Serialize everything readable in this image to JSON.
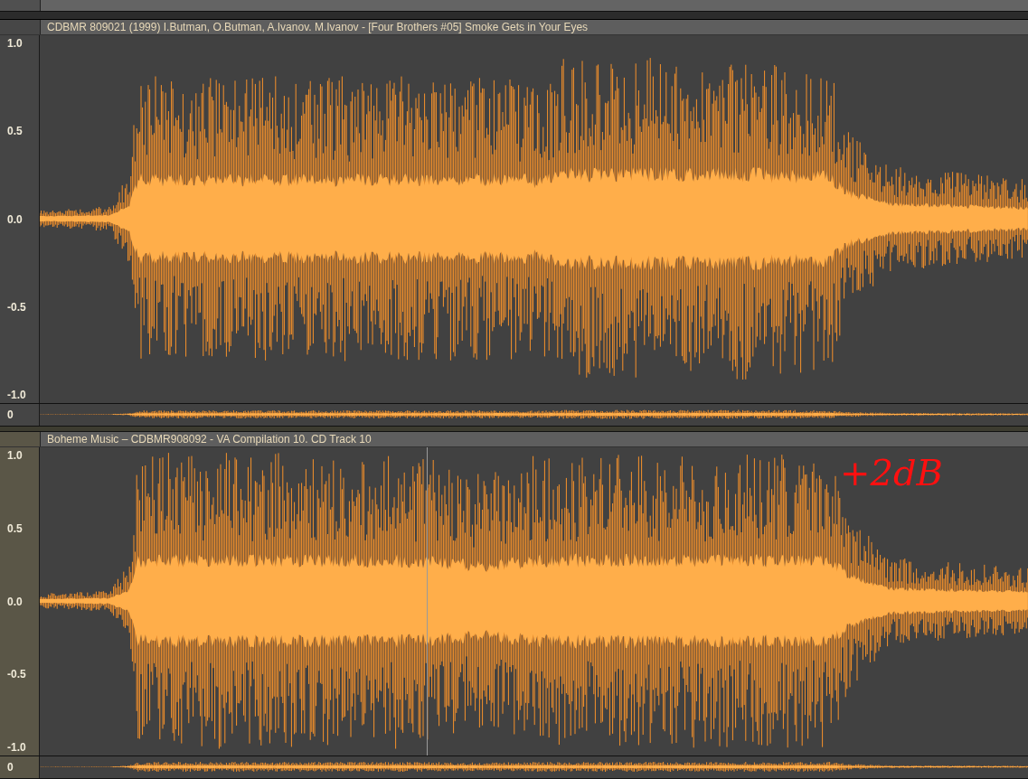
{
  "tracks": [
    {
      "title": "CDBMR 809021 (1999)  I.Butman, O.Butman, A.Ivanov. M.Ivanov - [Four Brothers #05] Smoke Gets in Your Eyes",
      "selected": false,
      "ticks": [
        "1.0",
        "0.5",
        "0.0",
        "-0.5",
        "-1.0"
      ],
      "overview_label": "0"
    },
    {
      "title": "Boheme Music – CDBMR908092 - VA Compilation 10. CD Track 10",
      "selected": true,
      "ticks": [
        "1.0",
        "0.5",
        "0.0",
        "-0.5",
        "-1.0"
      ],
      "overview_label": "0",
      "annotation": "+2dB"
    }
  ]
}
